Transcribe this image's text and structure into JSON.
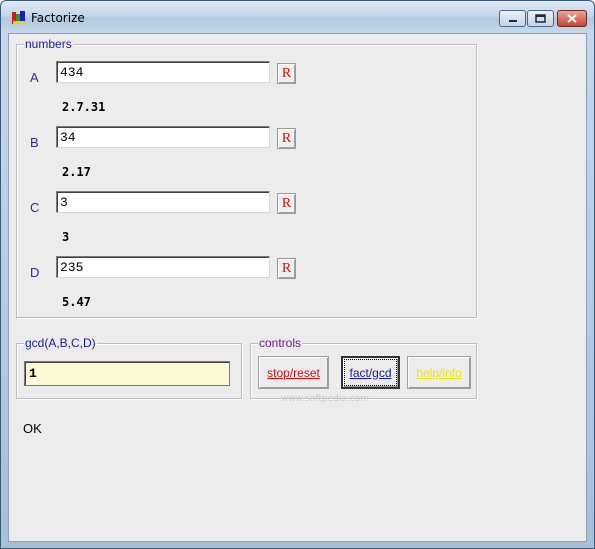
{
  "window": {
    "title": "Factorize"
  },
  "numbers_group": {
    "legend": "numbers",
    "rows": [
      {
        "letter": "A",
        "value": "434",
        "reset_label": "R",
        "factors": "2.7.31"
      },
      {
        "letter": "B",
        "value": "34",
        "reset_label": "R",
        "factors": "2.17"
      },
      {
        "letter": "C",
        "value": "3",
        "reset_label": "R",
        "factors": "3"
      },
      {
        "letter": "D",
        "value": "235",
        "reset_label": "R",
        "factors": "5.47"
      }
    ]
  },
  "gcd_group": {
    "legend": "gcd(A,B,C,D)",
    "value": "1"
  },
  "controls_group": {
    "legend": "controls",
    "stop_reset_label": "stop/reset",
    "fact_gcd_label": "fact/gcd",
    "help_info_label": "help/info"
  },
  "status": {
    "text": "OK"
  },
  "watermark": {
    "text": "www.softpedia.com"
  },
  "colors": {
    "legend_numbers": "#1a1aa0",
    "legend_gcd": "#1a1aa0",
    "legend_controls": "#6a1a8a",
    "stop_reset": "#d01010",
    "fact_gcd": "#1a1aa0",
    "help_info": "#e8e800",
    "reset_r": "#d21010"
  },
  "icons": {
    "app": "app-icon",
    "minimize": "minimize-icon",
    "maximize": "maximize-icon",
    "close": "close-icon"
  }
}
